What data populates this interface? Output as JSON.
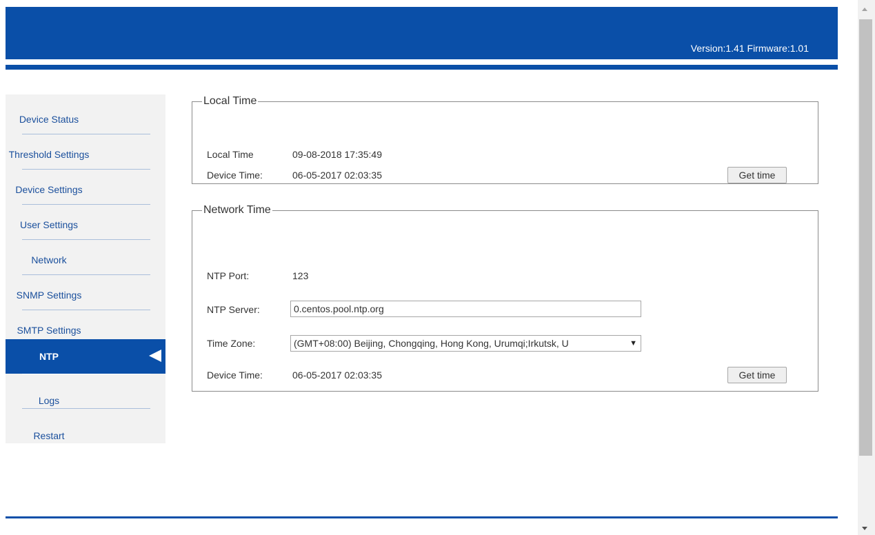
{
  "header": {
    "version_text": "Version:1.41 Firmware:1.01"
  },
  "sidebar": {
    "items": [
      {
        "label": "Device Status"
      },
      {
        "label": "Threshold Settings"
      },
      {
        "label": "Device Settings"
      },
      {
        "label": "User Settings"
      },
      {
        "label": "Network"
      },
      {
        "label": "SNMP Settings"
      },
      {
        "label": "SMTP Settings"
      },
      {
        "label": "NTP",
        "active": true
      },
      {
        "label": "Logs"
      },
      {
        "label": "Restart"
      }
    ]
  },
  "local_time": {
    "legend": "Local Time",
    "local_time_label": "Local Time",
    "local_time_value": "09-08-2018 17:35:49",
    "device_time_label": "Device Time:",
    "device_time_value": "06-05-2017 02:03:35",
    "get_time_button": "Get time"
  },
  "network_time": {
    "legend": "Network Time",
    "ntp_port_label": "NTP Port:",
    "ntp_port_value": "123",
    "ntp_server_label": "NTP Server:",
    "ntp_server_value": "0.centos.pool.ntp.org",
    "time_zone_label": "Time Zone:",
    "time_zone_value": "(GMT+08:00) Beijing, Chongqing, Hong Kong, Urumqi;Irkutsk, U",
    "device_time_label": "Device Time:",
    "device_time_value": "06-05-2017 02:03:35",
    "get_time_button": "Get time"
  },
  "colors": {
    "brand_blue": "#0a4fa8",
    "sidebar_bg": "#f2f2f2",
    "nav_text": "#1a4f9c"
  },
  "icons": {
    "active_indicator": "triangle-left-icon",
    "select_caret": "caret-down-icon"
  }
}
